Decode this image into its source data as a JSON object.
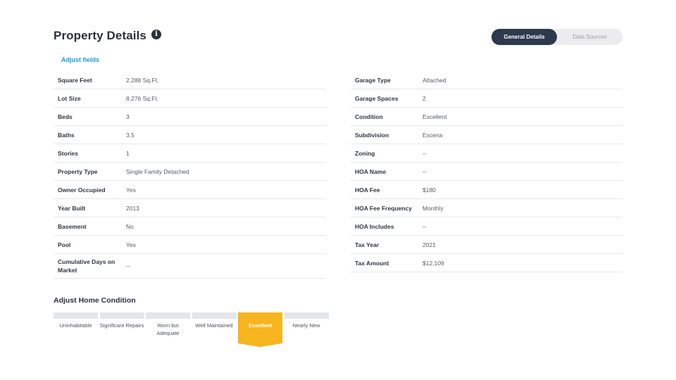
{
  "header": {
    "title": "Property Details",
    "info_icon": "info-icon"
  },
  "toggle": {
    "active_label": "General Details",
    "inactive_label": "Data Sources"
  },
  "adjust_fields_label": "Adjust fields",
  "left_details": [
    {
      "label": "Square Feet",
      "value": "2,288 Sq.Ft."
    },
    {
      "label": "Lot Size",
      "value": "8,276 Sq.Ft."
    },
    {
      "label": "Beds",
      "value": "3"
    },
    {
      "label": "Baths",
      "value": "3.5"
    },
    {
      "label": "Stories",
      "value": "1"
    },
    {
      "label": "Property Type",
      "value": "Single Family Detached"
    },
    {
      "label": "Owner Occupied",
      "value": "Yes"
    },
    {
      "label": "Year Built",
      "value": "2013"
    },
    {
      "label": "Basement",
      "value": "No"
    },
    {
      "label": "Pool",
      "value": "Yes"
    },
    {
      "label": "Cumulative Days on Market",
      "value": "--"
    }
  ],
  "right_details": [
    {
      "label": "Garage Type",
      "value": "Attached"
    },
    {
      "label": "Garage Spaces",
      "value": "2"
    },
    {
      "label": "Condition",
      "value": "Excellent"
    },
    {
      "label": "Subdivision",
      "value": "Escena"
    },
    {
      "label": "Zoning",
      "value": "--"
    },
    {
      "label": "HOA Name",
      "value": "--"
    },
    {
      "label": "HOA Fee",
      "value": "$180"
    },
    {
      "label": "HOA Fee Frequency",
      "value": "Monthly"
    },
    {
      "label": "HOA Includes",
      "value": "--"
    },
    {
      "label": "Tax Year",
      "value": "2021"
    },
    {
      "label": "Tax Amount",
      "value": "$12,109"
    }
  ],
  "condition": {
    "title": "Adjust Home Condition",
    "options": [
      {
        "label": "Uninhabitable",
        "selected": false
      },
      {
        "label": "Significant Repairs",
        "selected": false
      },
      {
        "label": "Worn but Adequate",
        "selected": false
      },
      {
        "label": "Well Maintained",
        "selected": false
      },
      {
        "label": "Excellent",
        "selected": true
      },
      {
        "label": "Nearly New",
        "selected": false
      }
    ],
    "accent_color": "#f6b51e"
  },
  "colors": {
    "link": "#1b9bd6",
    "toggle_active": "#2c3a4c"
  }
}
